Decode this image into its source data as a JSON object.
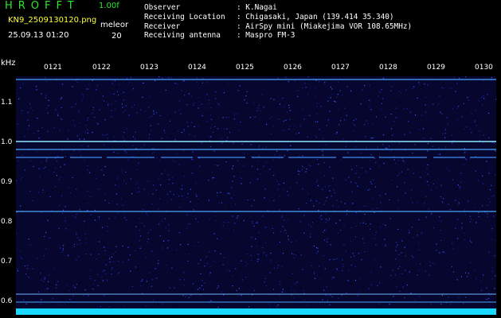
{
  "header": {
    "title": "HROFFT",
    "version": "1.00f",
    "filename": "KN9_2509130120.png",
    "mode": "meleor",
    "datetime": "25.09.13 01:20",
    "count": "20"
  },
  "station": [
    {
      "label": "Observer",
      "value": ": K.Nagai"
    },
    {
      "label": "Receiving Location",
      "value": ": Chigasaki, Japan (139.414 35.340)"
    },
    {
      "label": "Receiver",
      "value": ": AirSpy mini (Miakejima VOR 108.65MHz)"
    },
    {
      "label": "Receiving antenna",
      "value": ": Maspro FM-3"
    }
  ],
  "axis": {
    "y_unit": "kHz",
    "y_ticks": [
      "1.1",
      "1.0",
      "0.9",
      "0.8",
      "0.7",
      "0.6"
    ],
    "x_ticks": [
      "0121",
      "0122",
      "0123",
      "0124",
      "0125",
      "0126",
      "0127",
      "0128",
      "0129",
      "0130"
    ]
  },
  "colors": {
    "background": "#000000",
    "plot_noise": "#06062e",
    "signal_line": "#4aa8ff",
    "strong_line": "#8fe8ff",
    "bottom_band": "#1ad8ff",
    "title_green": "#2ee62e"
  }
}
